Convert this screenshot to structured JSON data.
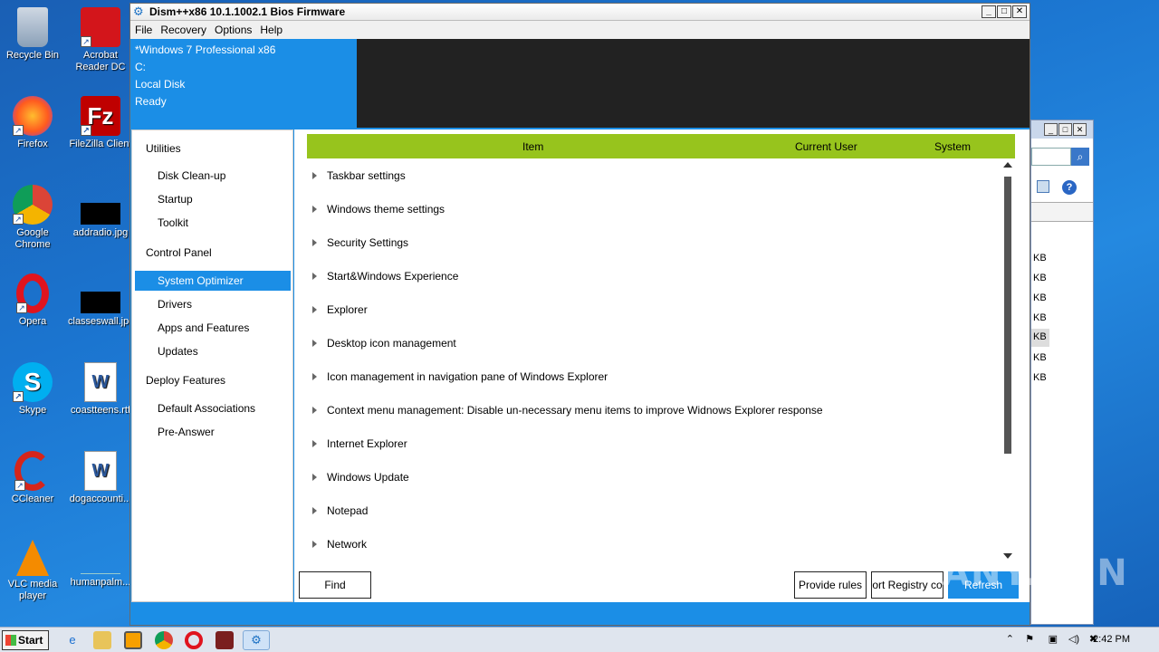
{
  "desktop": {
    "icons": [
      {
        "label": "Recycle Bin"
      },
      {
        "label": "Acrobat Reader DC"
      },
      {
        "label": "Firefox"
      },
      {
        "label": "FileZilla Client"
      },
      {
        "label": "Google Chrome"
      },
      {
        "label": "addradio.jpg"
      },
      {
        "label": "Opera"
      },
      {
        "label": "classeswall.jpg"
      },
      {
        "label": "Skype"
      },
      {
        "label": "coastteens.rtf"
      },
      {
        "label": "CCleaner"
      },
      {
        "label": "dogaccounti..."
      },
      {
        "label": "VLC media player"
      },
      {
        "label": "humanpalm..."
      }
    ]
  },
  "window": {
    "title": "Dism++x86 10.1.1002.1 Bios Firmware",
    "menu": [
      "File",
      "Recovery",
      "Options",
      "Help"
    ],
    "info": [
      "*Windows 7 Professional x86",
      "C:",
      "Local Disk",
      "Ready"
    ]
  },
  "sidebar": {
    "groups": [
      {
        "title": "Utilities",
        "items": [
          "Disk Clean-up",
          "Startup",
          "Toolkit"
        ]
      },
      {
        "title": "Control Panel",
        "items": [
          "System Optimizer",
          "Drivers",
          "Apps and Features",
          "Updates"
        ]
      },
      {
        "title": "Deploy Features",
        "items": [
          "Default Associations",
          "Pre-Answer"
        ]
      }
    ],
    "selected": "System Optimizer"
  },
  "table": {
    "headers": {
      "item": "Item",
      "current_user": "Current User",
      "system": "System"
    },
    "rows": [
      "Taskbar settings",
      "Windows theme settings",
      "Security Settings",
      "Start&Windows Experience",
      "Explorer",
      "Desktop icon management",
      "Icon management in navigation pane of Windows Explorer",
      "Context menu management: Disable un-necessary menu items to improve Widnows Explorer response",
      "Internet Explorer",
      "Windows Update",
      "Notepad",
      "Network"
    ]
  },
  "buttons": {
    "find": "Find",
    "provide_rules": "Provide rules",
    "import_registry": "ort Registry co",
    "refresh": "Refresh"
  },
  "background_window": {
    "sizes": [
      "KB",
      "KB",
      "KB",
      "KB",
      "KB",
      "KB",
      "KB"
    ]
  },
  "taskbar": {
    "start": "Start",
    "clock": "2:42 PM"
  },
  "watermark": "ANY.RUN",
  "colors": {
    "accent": "#1b8ee6",
    "header": "#97c41d",
    "dark_panel": "#222222"
  }
}
